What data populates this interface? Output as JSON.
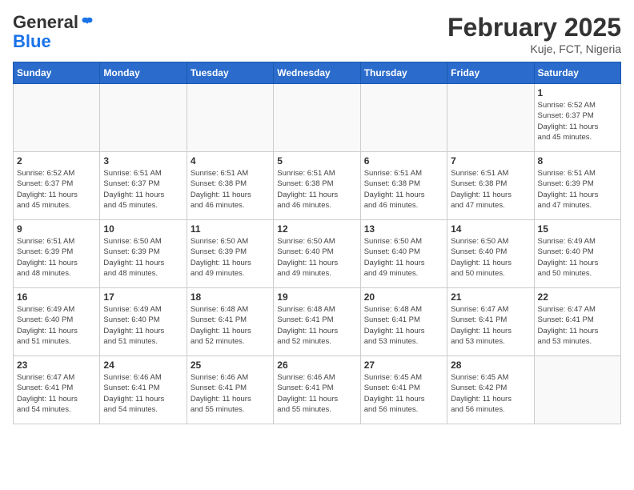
{
  "header": {
    "logo_general": "General",
    "logo_blue": "Blue",
    "month_title": "February 2025",
    "location": "Kuje, FCT, Nigeria"
  },
  "days_of_week": [
    "Sunday",
    "Monday",
    "Tuesday",
    "Wednesday",
    "Thursday",
    "Friday",
    "Saturday"
  ],
  "weeks": [
    [
      {
        "day": "",
        "info": ""
      },
      {
        "day": "",
        "info": ""
      },
      {
        "day": "",
        "info": ""
      },
      {
        "day": "",
        "info": ""
      },
      {
        "day": "",
        "info": ""
      },
      {
        "day": "",
        "info": ""
      },
      {
        "day": "1",
        "info": "Sunrise: 6:52 AM\nSunset: 6:37 PM\nDaylight: 11 hours\nand 45 minutes."
      }
    ],
    [
      {
        "day": "2",
        "info": "Sunrise: 6:52 AM\nSunset: 6:37 PM\nDaylight: 11 hours\nand 45 minutes."
      },
      {
        "day": "3",
        "info": "Sunrise: 6:51 AM\nSunset: 6:37 PM\nDaylight: 11 hours\nand 45 minutes."
      },
      {
        "day": "4",
        "info": "Sunrise: 6:51 AM\nSunset: 6:38 PM\nDaylight: 11 hours\nand 46 minutes."
      },
      {
        "day": "5",
        "info": "Sunrise: 6:51 AM\nSunset: 6:38 PM\nDaylight: 11 hours\nand 46 minutes."
      },
      {
        "day": "6",
        "info": "Sunrise: 6:51 AM\nSunset: 6:38 PM\nDaylight: 11 hours\nand 46 minutes."
      },
      {
        "day": "7",
        "info": "Sunrise: 6:51 AM\nSunset: 6:38 PM\nDaylight: 11 hours\nand 47 minutes."
      },
      {
        "day": "8",
        "info": "Sunrise: 6:51 AM\nSunset: 6:39 PM\nDaylight: 11 hours\nand 47 minutes."
      }
    ],
    [
      {
        "day": "9",
        "info": "Sunrise: 6:51 AM\nSunset: 6:39 PM\nDaylight: 11 hours\nand 48 minutes."
      },
      {
        "day": "10",
        "info": "Sunrise: 6:50 AM\nSunset: 6:39 PM\nDaylight: 11 hours\nand 48 minutes."
      },
      {
        "day": "11",
        "info": "Sunrise: 6:50 AM\nSunset: 6:39 PM\nDaylight: 11 hours\nand 49 minutes."
      },
      {
        "day": "12",
        "info": "Sunrise: 6:50 AM\nSunset: 6:40 PM\nDaylight: 11 hours\nand 49 minutes."
      },
      {
        "day": "13",
        "info": "Sunrise: 6:50 AM\nSunset: 6:40 PM\nDaylight: 11 hours\nand 49 minutes."
      },
      {
        "day": "14",
        "info": "Sunrise: 6:50 AM\nSunset: 6:40 PM\nDaylight: 11 hours\nand 50 minutes."
      },
      {
        "day": "15",
        "info": "Sunrise: 6:49 AM\nSunset: 6:40 PM\nDaylight: 11 hours\nand 50 minutes."
      }
    ],
    [
      {
        "day": "16",
        "info": "Sunrise: 6:49 AM\nSunset: 6:40 PM\nDaylight: 11 hours\nand 51 minutes."
      },
      {
        "day": "17",
        "info": "Sunrise: 6:49 AM\nSunset: 6:40 PM\nDaylight: 11 hours\nand 51 minutes."
      },
      {
        "day": "18",
        "info": "Sunrise: 6:48 AM\nSunset: 6:41 PM\nDaylight: 11 hours\nand 52 minutes."
      },
      {
        "day": "19",
        "info": "Sunrise: 6:48 AM\nSunset: 6:41 PM\nDaylight: 11 hours\nand 52 minutes."
      },
      {
        "day": "20",
        "info": "Sunrise: 6:48 AM\nSunset: 6:41 PM\nDaylight: 11 hours\nand 53 minutes."
      },
      {
        "day": "21",
        "info": "Sunrise: 6:47 AM\nSunset: 6:41 PM\nDaylight: 11 hours\nand 53 minutes."
      },
      {
        "day": "22",
        "info": "Sunrise: 6:47 AM\nSunset: 6:41 PM\nDaylight: 11 hours\nand 53 minutes."
      }
    ],
    [
      {
        "day": "23",
        "info": "Sunrise: 6:47 AM\nSunset: 6:41 PM\nDaylight: 11 hours\nand 54 minutes."
      },
      {
        "day": "24",
        "info": "Sunrise: 6:46 AM\nSunset: 6:41 PM\nDaylight: 11 hours\nand 54 minutes."
      },
      {
        "day": "25",
        "info": "Sunrise: 6:46 AM\nSunset: 6:41 PM\nDaylight: 11 hours\nand 55 minutes."
      },
      {
        "day": "26",
        "info": "Sunrise: 6:46 AM\nSunset: 6:41 PM\nDaylight: 11 hours\nand 55 minutes."
      },
      {
        "day": "27",
        "info": "Sunrise: 6:45 AM\nSunset: 6:41 PM\nDaylight: 11 hours\nand 56 minutes."
      },
      {
        "day": "28",
        "info": "Sunrise: 6:45 AM\nSunset: 6:42 PM\nDaylight: 11 hours\nand 56 minutes."
      },
      {
        "day": "",
        "info": ""
      }
    ]
  ]
}
